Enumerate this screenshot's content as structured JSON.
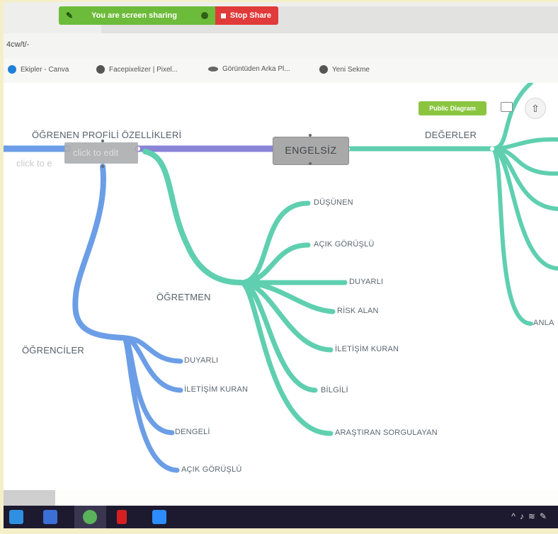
{
  "share_bar": {
    "status_label": "You are screen sharing",
    "stop_label": "Stop Share"
  },
  "browser": {
    "url": "4cw/t/-",
    "bookmarks": [
      {
        "label": "Ekipler - Canva",
        "icon": "canva-icon"
      },
      {
        "label": "Facepixelizer | Pixel...",
        "icon": "globe-icon"
      },
      {
        "label": "Görüntüden Arka Pl...",
        "icon": "eye-icon"
      },
      {
        "label": "Yeni Sekme",
        "icon": "globe-icon"
      }
    ]
  },
  "toolbar": {
    "public_diagram_label": "Public Diagram"
  },
  "diagram": {
    "main_title": "ÖĞRENEN PROFİLİ ÖZELLİKLERİ",
    "edit_placeholder": "click to edit",
    "ghost_text": "click to e",
    "center_node": "ENGELSİZ",
    "branches": {
      "degerler": "DEĞERLER",
      "ogretmen": "ÖĞRETMEN",
      "ogrenciler": "ÖĞRENCİLER",
      "anla": "ANLA"
    },
    "ogretmen_items": [
      "DÜŞÜNEN",
      "AÇIK GÖRÜŞLÜ",
      "DUYARLI",
      "RİSK ALAN",
      "İLETİŞİM KURAN",
      "BİLGİLİ",
      "ARAŞTIRAN SORGULAYAN"
    ],
    "ogrenciler_items": [
      "DUYARLI",
      "İLETİŞİM KURAN",
      "DENGELİ",
      "AÇIK GÖRÜŞLÜ"
    ],
    "colors": {
      "teal": "#5fcfb0",
      "blue": "#6b9ee6",
      "purple": "#8a84d8",
      "node_gray": "#a9a9a9"
    }
  },
  "taskbar": {
    "apps": [
      "file-explorer-icon",
      "mail-icon",
      "chrome-icon",
      "netflix-icon",
      "zoom-icon"
    ],
    "tray_icons": [
      "chevron-up-icon",
      "speaker-icon",
      "wifi-icon",
      "pen-icon"
    ]
  }
}
